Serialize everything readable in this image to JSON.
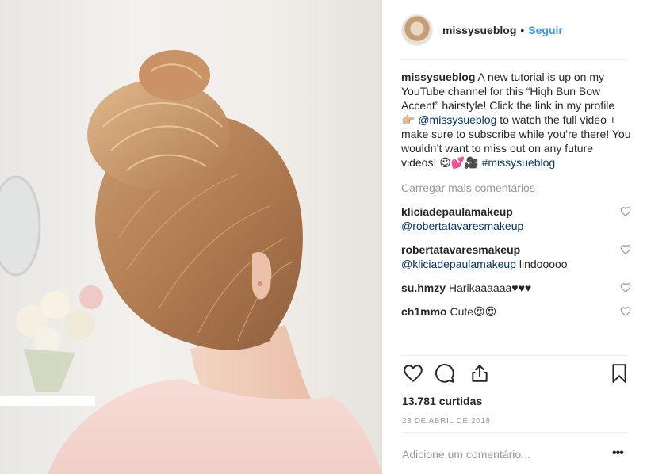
{
  "post": {
    "username": "missysueblog",
    "separator": "•",
    "follow_label": "Seguir",
    "caption": {
      "username": "missysueblog",
      "text_1": "A new tutorial is up on my YouTube channel for this “High Bun Bow Accent” hairstyle! Click the link in my profile 👉🏼",
      "mention": "@missysueblog",
      "text_2": "to watch the full video + make sure to subscribe while you’re there! You wouldn’t want to miss out on any future videos! 😉💕🎥",
      "hashtag": "#missysueblog"
    },
    "load_more_label": "Carregar mais comentários",
    "comments": [
      {
        "user": "kliciadepaulamakeup",
        "mention": "@robertatavaresmakeup",
        "text": ""
      },
      {
        "user": "robertatavaresmakeup",
        "mention": "@kliciadepaulamakeup",
        "text": "lindooooo"
      },
      {
        "user": "su.hmzy",
        "mention": "",
        "text": "Harikaaaaaa♥♥♥"
      },
      {
        "user": "ch1mmo",
        "mention": "",
        "text": "Cute😍😍"
      }
    ],
    "likes": "13.781 curtidas",
    "date": "23 DE ABRIL DE 2018",
    "add_comment_placeholder": "Adicione um comentário...",
    "more_options": "•••"
  },
  "icons": [
    "like-icon",
    "comment-icon",
    "share-icon",
    "bookmark-icon",
    "small-heart-icon"
  ],
  "colors": {
    "link": "#3897f0",
    "mention": "#003569",
    "muted": "#999999",
    "text": "#262626"
  }
}
